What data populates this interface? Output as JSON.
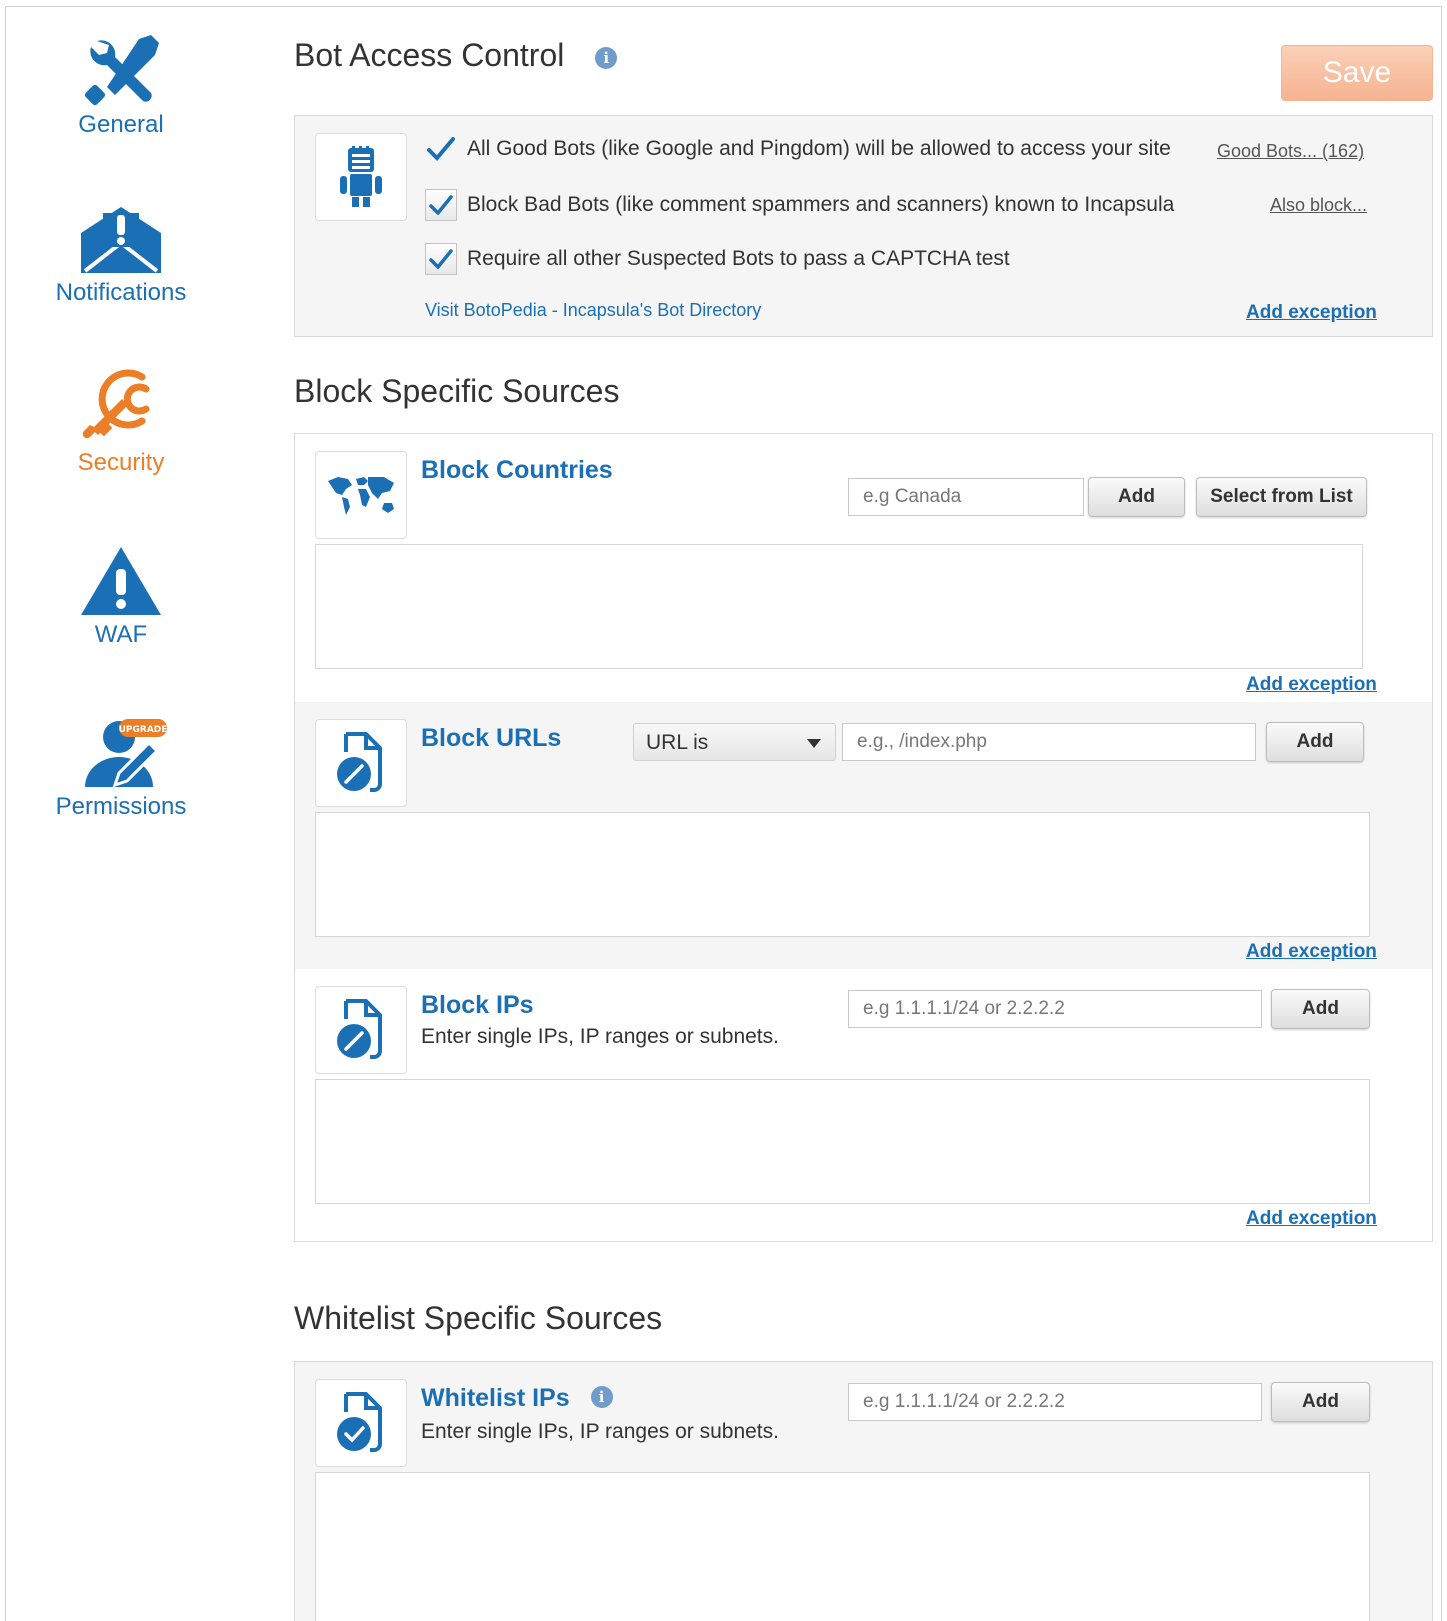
{
  "sidebar": {
    "items": [
      {
        "label": "General",
        "icon": "tools-icon"
      },
      {
        "label": "Notifications",
        "icon": "envelope-alert-icon"
      },
      {
        "label": "Security",
        "icon": "security-key-icon"
      },
      {
        "label": "WAF",
        "icon": "warning-triangle-icon"
      },
      {
        "label": "Permissions",
        "icon": "user-edit-icon",
        "badge": "UPGRADE"
      }
    ],
    "active": "Security"
  },
  "header": {
    "title": "Bot Access Control",
    "save_label": "Save"
  },
  "bot_access": {
    "good_bots_text": "All Good Bots (like Google and Pingdom) will be allowed to access your site",
    "good_bots_link": "Good Bots... (162)",
    "bad_bots_text": "Block Bad Bots (like comment spammers and scanners) known to Incapsula",
    "bad_bots_checked": true,
    "also_block_link": "Also block...",
    "captcha_text": "Require all other Suspected Bots to pass a CAPTCHA test",
    "captcha_checked": true,
    "botopedia_link": "Visit BotoPedia - Incapsula's Bot Directory",
    "add_exception": "Add exception"
  },
  "block_sources": {
    "title": "Block Specific Sources",
    "countries": {
      "title": "Block Countries",
      "placeholder": "e.g Canada",
      "add_label": "Add",
      "select_label": "Select from List",
      "add_exception": "Add exception"
    },
    "urls": {
      "title": "Block URLs",
      "select_value": "URL is",
      "placeholder": "e.g., /index.php",
      "add_label": "Add",
      "add_exception": "Add exception"
    },
    "ips": {
      "title": "Block IPs",
      "description": "Enter single IPs, IP ranges or subnets.",
      "placeholder": "e.g 1.1.1.1/24 or 2.2.2.2",
      "add_label": "Add",
      "add_exception": "Add exception"
    }
  },
  "whitelist_sources": {
    "title": "Whitelist Specific Sources",
    "ips": {
      "title": "Whitelist IPs",
      "description": "Enter single IPs, IP ranges or subnets.",
      "placeholder": "e.g 1.1.1.1/24 or 2.2.2.2",
      "add_label": "Add"
    }
  },
  "colors": {
    "brand_blue": "#1b6fb5",
    "active_orange": "#ec7e27",
    "save_disabled": "#f6b391"
  }
}
